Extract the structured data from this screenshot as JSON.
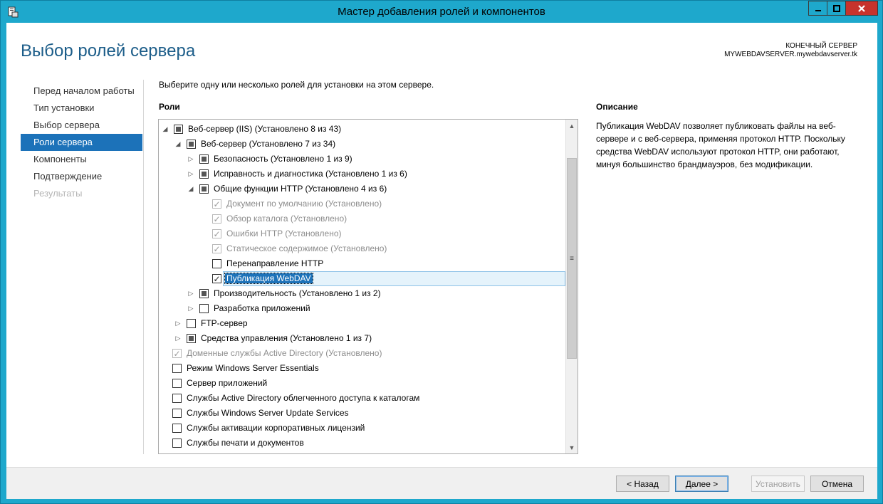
{
  "window": {
    "title": "Мастер добавления ролей и компонентов"
  },
  "header": {
    "page_title": "Выбор ролей сервера",
    "dest_label": "КОНЕЧНЫЙ СЕРВЕР",
    "dest_server": "MYWEBDAVSERVER.mywebdavserver.tk"
  },
  "nav": {
    "items": [
      {
        "label": "Перед началом работы",
        "state": "normal"
      },
      {
        "label": "Тип установки",
        "state": "normal"
      },
      {
        "label": "Выбор сервера",
        "state": "normal"
      },
      {
        "label": "Роли сервера",
        "state": "active"
      },
      {
        "label": "Компоненты",
        "state": "normal"
      },
      {
        "label": "Подтверждение",
        "state": "normal"
      },
      {
        "label": "Результаты",
        "state": "disabled"
      }
    ]
  },
  "main": {
    "instruction": "Выберите одну или несколько ролей для установки на этом сервере.",
    "roles_label": "Роли",
    "tree": [
      {
        "label": "Веб-сервер (IIS) (Установлено 8 из 43)",
        "level": 0,
        "expander": "expanded",
        "check": "partial",
        "disabled": false
      },
      {
        "label": "Веб-сервер (Установлено 7 из 34)",
        "level": 1,
        "expander": "expanded",
        "check": "partial",
        "disabled": false
      },
      {
        "label": "Безопасность (Установлено 1 из 9)",
        "level": 2,
        "expander": "collapsed",
        "check": "partial",
        "disabled": false
      },
      {
        "label": "Исправность и диагностика (Установлено 1 из 6)",
        "level": 2,
        "expander": "collapsed",
        "check": "partial",
        "disabled": false
      },
      {
        "label": "Общие функции HTTP (Установлено 4 из 6)",
        "level": 2,
        "expander": "expanded",
        "check": "partial",
        "disabled": false
      },
      {
        "label": "Документ по умолчанию (Установлено)",
        "level": 3,
        "expander": "none",
        "check": "checked",
        "disabled": true
      },
      {
        "label": "Обзор каталога (Установлено)",
        "level": 3,
        "expander": "none",
        "check": "checked",
        "disabled": true
      },
      {
        "label": "Ошибки HTTP (Установлено)",
        "level": 3,
        "expander": "none",
        "check": "checked",
        "disabled": true
      },
      {
        "label": "Статическое содержимое (Установлено)",
        "level": 3,
        "expander": "none",
        "check": "checked",
        "disabled": true
      },
      {
        "label": "Перенаправление HTTP",
        "level": 3,
        "expander": "none",
        "check": "unchecked",
        "disabled": false
      },
      {
        "label": "Публикация WebDAV",
        "level": 3,
        "expander": "none",
        "check": "checked",
        "disabled": false,
        "selected": true
      },
      {
        "label": "Производительность (Установлено 1 из 2)",
        "level": 2,
        "expander": "collapsed",
        "check": "partial",
        "disabled": false
      },
      {
        "label": "Разработка приложений",
        "level": 2,
        "expander": "collapsed",
        "check": "unchecked",
        "disabled": false
      },
      {
        "label": "FTP-сервер",
        "level": 1,
        "expander": "collapsed",
        "check": "unchecked",
        "disabled": false
      },
      {
        "label": "Средства управления (Установлено 1 из 7)",
        "level": 1,
        "expander": "collapsed",
        "check": "partial",
        "disabled": false
      },
      {
        "label": "Доменные службы Active Directory (Установлено)",
        "level": 0,
        "expander": "none",
        "check": "checked",
        "disabled": true
      },
      {
        "label": "Режим Windows Server Essentials",
        "level": 0,
        "expander": "none",
        "check": "unchecked",
        "disabled": false
      },
      {
        "label": "Сервер приложений",
        "level": 0,
        "expander": "none",
        "check": "unchecked",
        "disabled": false
      },
      {
        "label": "Службы Active Directory облегченного доступа к каталогам",
        "level": 0,
        "expander": "none",
        "check": "unchecked",
        "disabled": false
      },
      {
        "label": "Службы Windows Server Update Services",
        "level": 0,
        "expander": "none",
        "check": "unchecked",
        "disabled": false
      },
      {
        "label": "Службы активации корпоративных лицензий",
        "level": 0,
        "expander": "none",
        "check": "unchecked",
        "disabled": false
      },
      {
        "label": "Службы печати и документов",
        "level": 0,
        "expander": "none",
        "check": "unchecked",
        "disabled": false
      }
    ]
  },
  "description": {
    "title": "Описание",
    "text": "Публикация WebDAV позволяет публиковать файлы на веб-сервере и с веб-сервера, применяя протокол HTTP. Поскольку средства WebDAV используют протокол HTTP, они работают, минуя большинство брандмауэров, без модификации."
  },
  "footer": {
    "back_label": "< Назад",
    "next_label": "Далее >",
    "install_label": "Установить",
    "cancel_label": "Отмена"
  }
}
